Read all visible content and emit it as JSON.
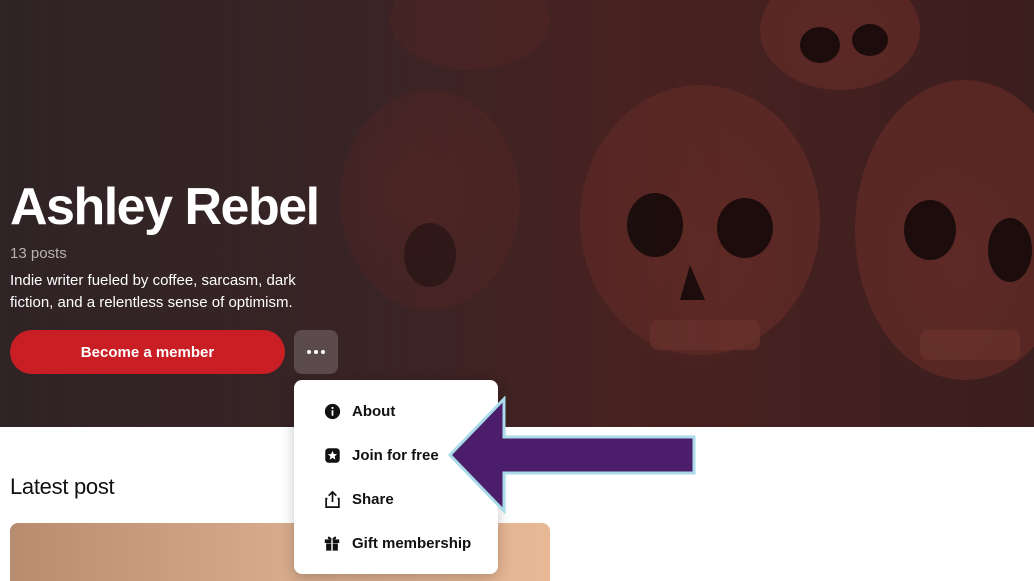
{
  "hero": {
    "creator_name": "Ashley Rebel",
    "post_count": "13 posts",
    "tagline": "Indie writer fueled by coffee, sarcasm, dark fiction, and a relentless sense of optimism.",
    "become_member_label": "Become a member",
    "more_icon": "more-horizontal-icon"
  },
  "menu": {
    "items": [
      {
        "label": "About",
        "icon": "info-icon"
      },
      {
        "label": "Join for free",
        "icon": "star-badge-icon"
      },
      {
        "label": "Share",
        "icon": "share-icon"
      },
      {
        "label": "Gift membership",
        "icon": "gift-icon"
      }
    ]
  },
  "main": {
    "latest_heading": "Latest post"
  },
  "colors": {
    "accent": "#c81e24",
    "annotation_arrow": "#4b1d6b",
    "annotation_arrow_outline": "#a9dbe8"
  }
}
